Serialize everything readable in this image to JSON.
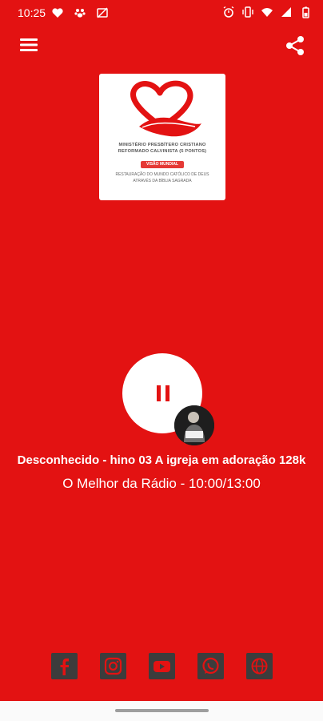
{
  "status_bar": {
    "time": "10:25",
    "left_icons": [
      "heart-icon",
      "paw-icon",
      "cast-off-icon"
    ],
    "right_icons": [
      "alarm-icon",
      "vibrate-icon",
      "wifi-icon",
      "signal-icon",
      "battery-icon"
    ]
  },
  "toolbar": {
    "menu_icon": "hamburger-menu-icon",
    "share_icon": "share-icon"
  },
  "logo": {
    "line1": "MINISTÉRIO PRESBÍTERO CRISTIANO",
    "line2": "REFORMADO CALVINISTA (5 PONTOS)",
    "badge": "VISÃO MUNDIAL",
    "line3": "RESTAURAÇÃO DO MUNDO CATÓLICO DE DEUS",
    "line4": "ATRAVÉS DA BÍBLIA SAGRADA"
  },
  "player": {
    "state": "playing",
    "control_icon": "pause-icon",
    "avatar": "artist-avatar",
    "track_title": "Desconhecido - hino 03 A igreja em adoração 128k",
    "program": "O Melhor da Rádio - 10:00/13:00"
  },
  "social": [
    "facebook-icon",
    "instagram-icon",
    "youtube-icon",
    "whatsapp-icon",
    "globe-icon"
  ],
  "colors": {
    "background": "#e31212",
    "accent": "#e31212",
    "social_icon": "#3c3c3c"
  }
}
